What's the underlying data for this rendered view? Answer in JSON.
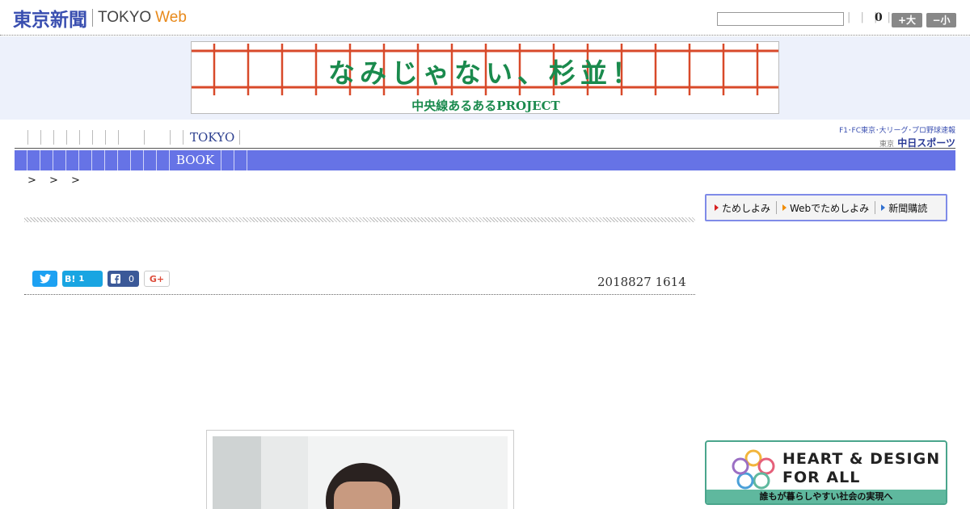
{
  "header": {
    "logo_ja": "東京新聞",
    "logo_en": "TOKYO",
    "logo_web": "Web",
    "search_placeholder": "",
    "mini_links": "| | | |",
    "count": "0",
    "size_up_label": "+大",
    "size_down_label": "−小"
  },
  "banner": {
    "title": "なみじゃない、杉並！",
    "subtitle": "中央線あるあるPROJECT"
  },
  "nav": {
    "tokyo_label": "TOKYO",
    "partner_top": "F1･FC東京･大リーグ･プロ野球速報",
    "partner_logo_small": "東京",
    "partner_logo": "中日スポーツ"
  },
  "subnav": {
    "book_label": "BOOK"
  },
  "breadcrumb": "> > >",
  "subscribe": {
    "item1": "ためしよみ",
    "item2": "Webでためしよみ",
    "item3": "新聞購読"
  },
  "share": {
    "hatena_label": "B!",
    "hatena_count": "1",
    "facebook_count": "0",
    "gplus_label": "G+"
  },
  "article": {
    "date": "2018827 1614"
  },
  "ad": {
    "line1": "HEART & DESIGN",
    "line2": "FOR ALL",
    "tagline": "誰もが暮らしやすい社会の実現へ"
  },
  "colors": {
    "logo_blue": "#3a4fb0",
    "web_orange": "#e8891a",
    "subnav_bg": "#6673e6",
    "banner_green": "#1a8a4d",
    "banner_red": "#d84a2a",
    "ad_green": "#5fb89e"
  }
}
